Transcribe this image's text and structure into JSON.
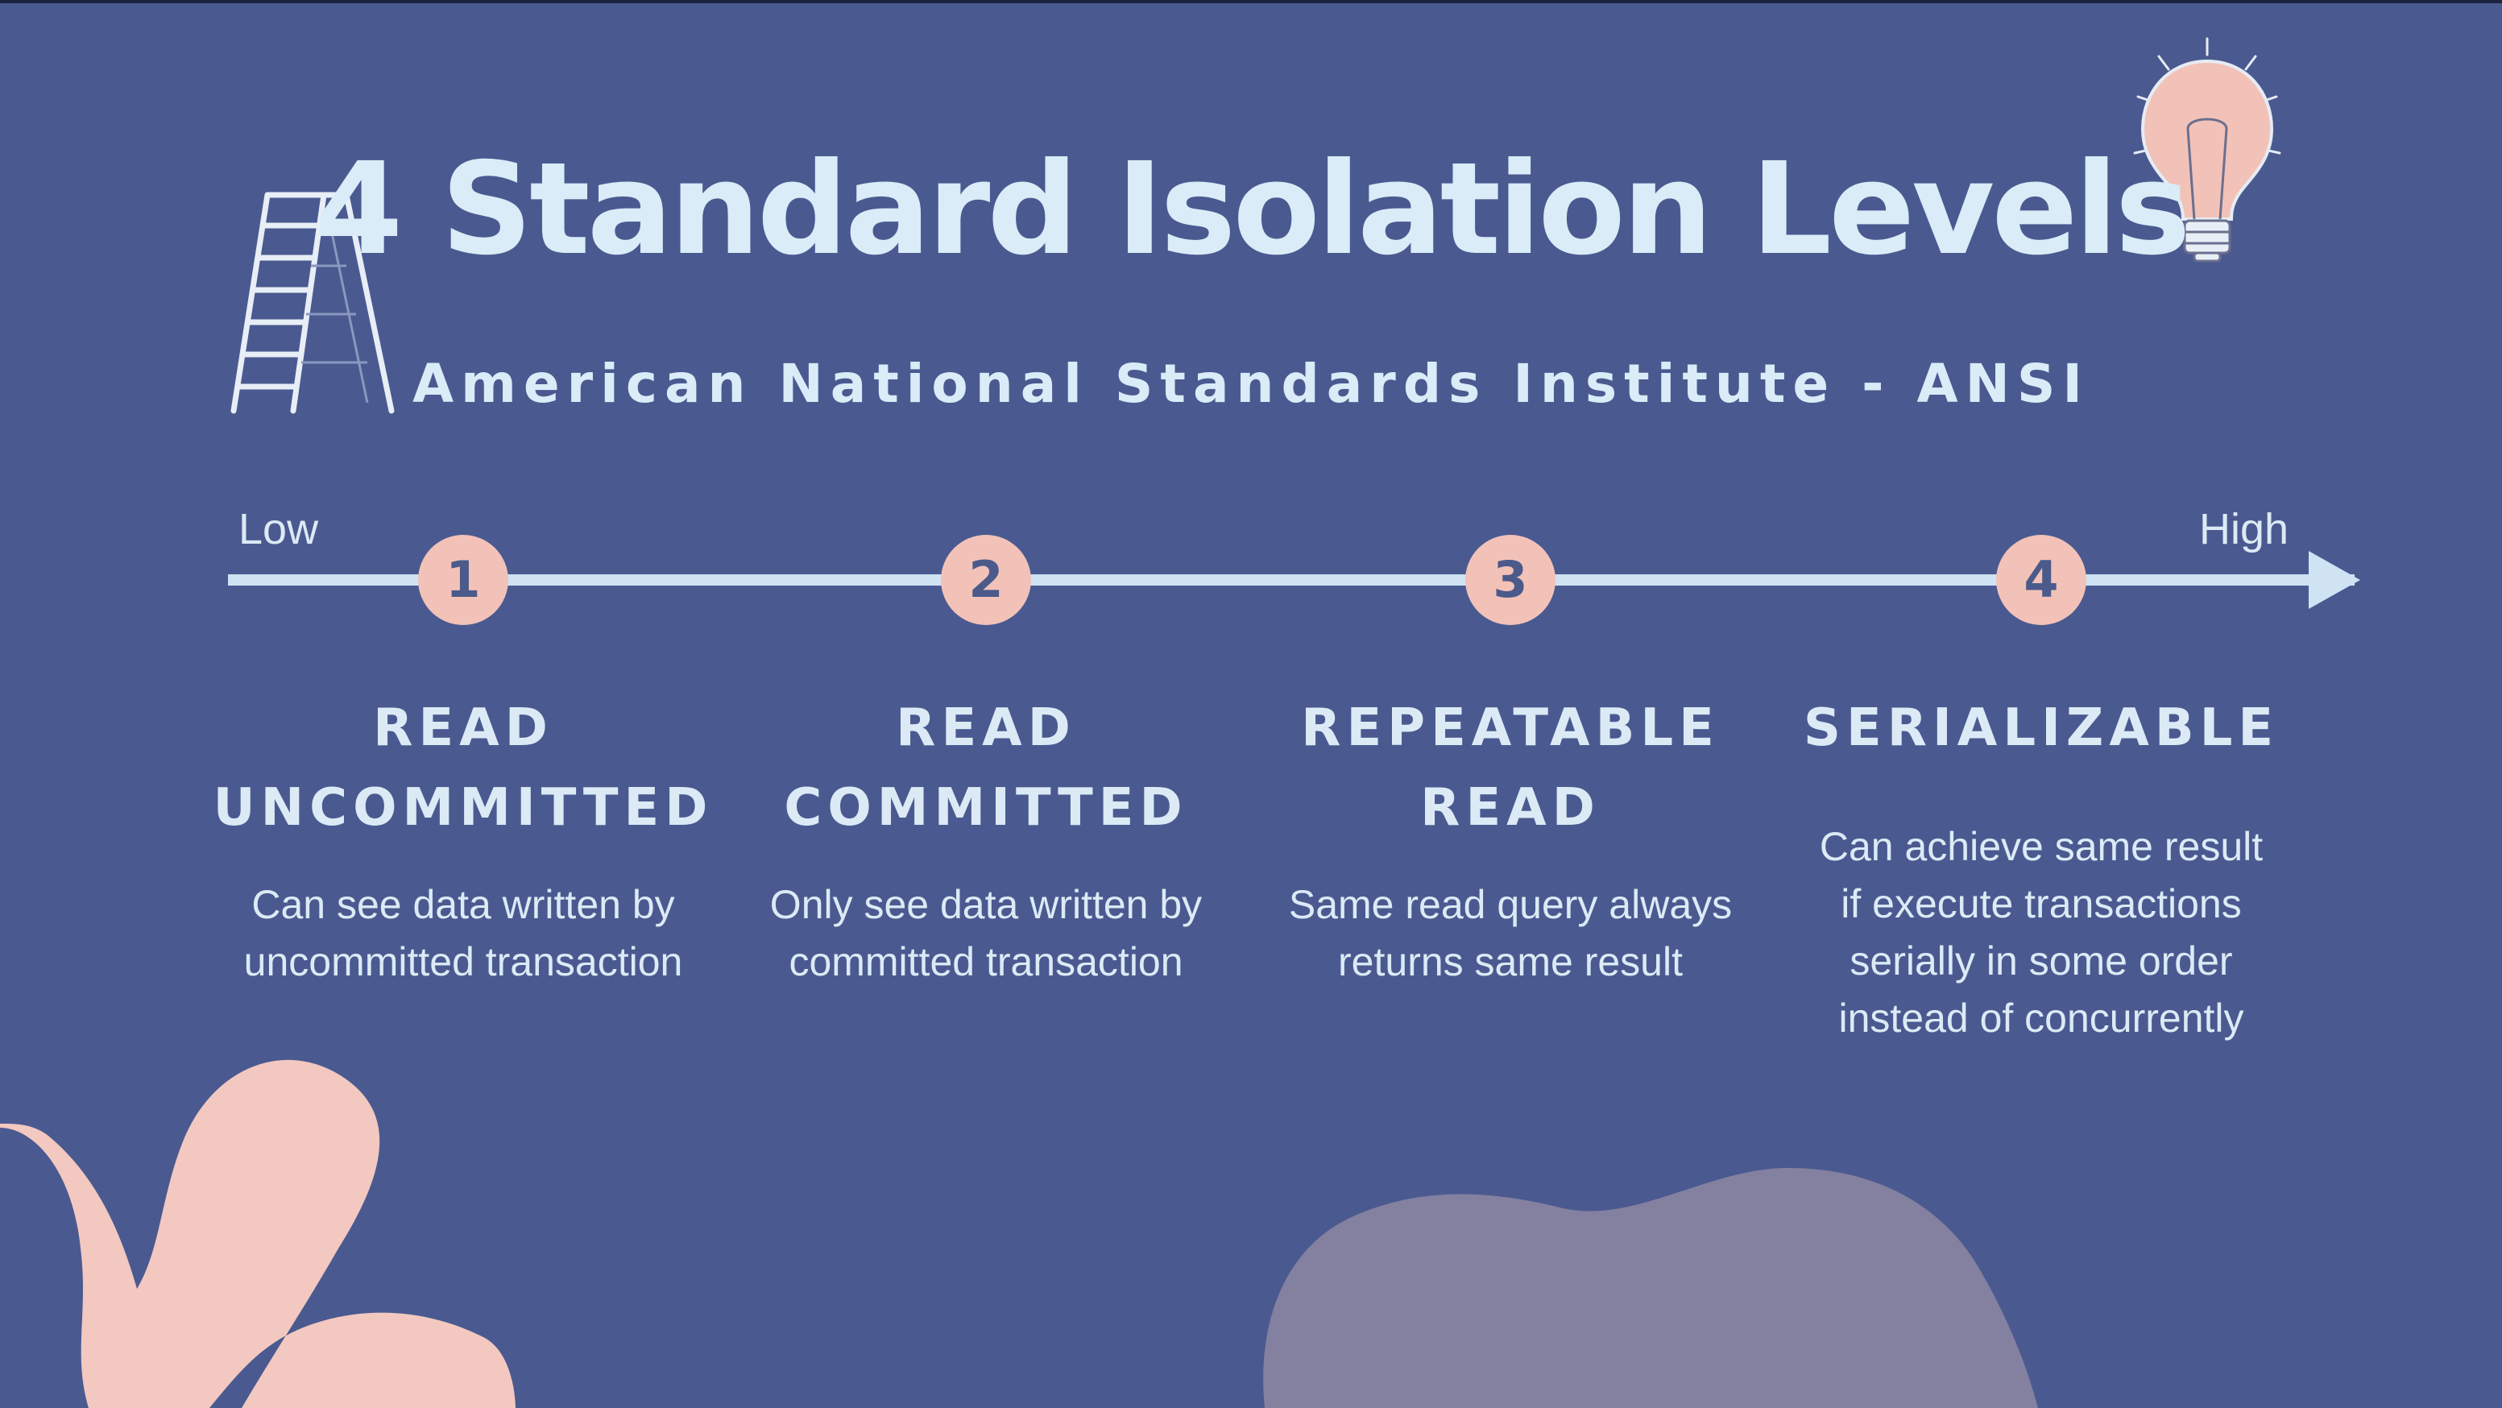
{
  "slide": {
    "title": "4 Standard Isolation Levels",
    "subtitle": "American National Standards Institute - ANSI",
    "scale": {
      "low_label": "Low",
      "high_label": "High"
    },
    "levels": [
      {
        "number": "1",
        "name": "READ\nUNCOMMITTED",
        "description": "Can see data written by\nuncommitted transaction"
      },
      {
        "number": "2",
        "name": "READ\nCOMMITTED",
        "description": "Only see data written by\ncommitted transaction"
      },
      {
        "number": "3",
        "name": "REPEATABLE\nREAD",
        "description": "Same read query always\nreturns same result"
      },
      {
        "number": "4",
        "name": "SERIALIZABLE",
        "description": "Can achieve same result\nif execute transactions\nserially in some order\ninstead of concurrently"
      }
    ]
  },
  "colors": {
    "background": "#4a5a90",
    "text": "#d9ecf7",
    "accent_pink": "#f2c2b8",
    "blob_purple": "#8480a0"
  },
  "icons": {
    "ladder": "ladder-icon",
    "bulb": "lightbulb-icon"
  }
}
